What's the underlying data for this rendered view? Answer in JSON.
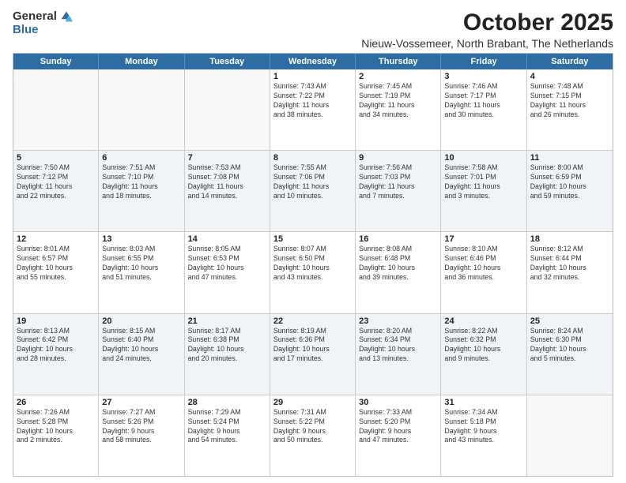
{
  "logo": {
    "general": "General",
    "blue": "Blue"
  },
  "title": "October 2025",
  "subtitle": "Nieuw-Vossemeer, North Brabant, The Netherlands",
  "headers": [
    "Sunday",
    "Monday",
    "Tuesday",
    "Wednesday",
    "Thursday",
    "Friday",
    "Saturday"
  ],
  "weeks": [
    [
      {
        "day": "",
        "info": ""
      },
      {
        "day": "",
        "info": ""
      },
      {
        "day": "",
        "info": ""
      },
      {
        "day": "1",
        "info": "Sunrise: 7:43 AM\nSunset: 7:22 PM\nDaylight: 11 hours\nand 38 minutes."
      },
      {
        "day": "2",
        "info": "Sunrise: 7:45 AM\nSunset: 7:19 PM\nDaylight: 11 hours\nand 34 minutes."
      },
      {
        "day": "3",
        "info": "Sunrise: 7:46 AM\nSunset: 7:17 PM\nDaylight: 11 hours\nand 30 minutes."
      },
      {
        "day": "4",
        "info": "Sunrise: 7:48 AM\nSunset: 7:15 PM\nDaylight: 11 hours\nand 26 minutes."
      }
    ],
    [
      {
        "day": "5",
        "info": "Sunrise: 7:50 AM\nSunset: 7:12 PM\nDaylight: 11 hours\nand 22 minutes."
      },
      {
        "day": "6",
        "info": "Sunrise: 7:51 AM\nSunset: 7:10 PM\nDaylight: 11 hours\nand 18 minutes."
      },
      {
        "day": "7",
        "info": "Sunrise: 7:53 AM\nSunset: 7:08 PM\nDaylight: 11 hours\nand 14 minutes."
      },
      {
        "day": "8",
        "info": "Sunrise: 7:55 AM\nSunset: 7:06 PM\nDaylight: 11 hours\nand 10 minutes."
      },
      {
        "day": "9",
        "info": "Sunrise: 7:56 AM\nSunset: 7:03 PM\nDaylight: 11 hours\nand 7 minutes."
      },
      {
        "day": "10",
        "info": "Sunrise: 7:58 AM\nSunset: 7:01 PM\nDaylight: 11 hours\nand 3 minutes."
      },
      {
        "day": "11",
        "info": "Sunrise: 8:00 AM\nSunset: 6:59 PM\nDaylight: 10 hours\nand 59 minutes."
      }
    ],
    [
      {
        "day": "12",
        "info": "Sunrise: 8:01 AM\nSunset: 6:57 PM\nDaylight: 10 hours\nand 55 minutes."
      },
      {
        "day": "13",
        "info": "Sunrise: 8:03 AM\nSunset: 6:55 PM\nDaylight: 10 hours\nand 51 minutes."
      },
      {
        "day": "14",
        "info": "Sunrise: 8:05 AM\nSunset: 6:53 PM\nDaylight: 10 hours\nand 47 minutes."
      },
      {
        "day": "15",
        "info": "Sunrise: 8:07 AM\nSunset: 6:50 PM\nDaylight: 10 hours\nand 43 minutes."
      },
      {
        "day": "16",
        "info": "Sunrise: 8:08 AM\nSunset: 6:48 PM\nDaylight: 10 hours\nand 39 minutes."
      },
      {
        "day": "17",
        "info": "Sunrise: 8:10 AM\nSunset: 6:46 PM\nDaylight: 10 hours\nand 36 minutes."
      },
      {
        "day": "18",
        "info": "Sunrise: 8:12 AM\nSunset: 6:44 PM\nDaylight: 10 hours\nand 32 minutes."
      }
    ],
    [
      {
        "day": "19",
        "info": "Sunrise: 8:13 AM\nSunset: 6:42 PM\nDaylight: 10 hours\nand 28 minutes."
      },
      {
        "day": "20",
        "info": "Sunrise: 8:15 AM\nSunset: 6:40 PM\nDaylight: 10 hours\nand 24 minutes."
      },
      {
        "day": "21",
        "info": "Sunrise: 8:17 AM\nSunset: 6:38 PM\nDaylight: 10 hours\nand 20 minutes."
      },
      {
        "day": "22",
        "info": "Sunrise: 8:19 AM\nSunset: 6:36 PM\nDaylight: 10 hours\nand 17 minutes."
      },
      {
        "day": "23",
        "info": "Sunrise: 8:20 AM\nSunset: 6:34 PM\nDaylight: 10 hours\nand 13 minutes."
      },
      {
        "day": "24",
        "info": "Sunrise: 8:22 AM\nSunset: 6:32 PM\nDaylight: 10 hours\nand 9 minutes."
      },
      {
        "day": "25",
        "info": "Sunrise: 8:24 AM\nSunset: 6:30 PM\nDaylight: 10 hours\nand 5 minutes."
      }
    ],
    [
      {
        "day": "26",
        "info": "Sunrise: 7:26 AM\nSunset: 5:28 PM\nDaylight: 10 hours\nand 2 minutes."
      },
      {
        "day": "27",
        "info": "Sunrise: 7:27 AM\nSunset: 5:26 PM\nDaylight: 9 hours\nand 58 minutes."
      },
      {
        "day": "28",
        "info": "Sunrise: 7:29 AM\nSunset: 5:24 PM\nDaylight: 9 hours\nand 54 minutes."
      },
      {
        "day": "29",
        "info": "Sunrise: 7:31 AM\nSunset: 5:22 PM\nDaylight: 9 hours\nand 50 minutes."
      },
      {
        "day": "30",
        "info": "Sunrise: 7:33 AM\nSunset: 5:20 PM\nDaylight: 9 hours\nand 47 minutes."
      },
      {
        "day": "31",
        "info": "Sunrise: 7:34 AM\nSunset: 5:18 PM\nDaylight: 9 hours\nand 43 minutes."
      },
      {
        "day": "",
        "info": ""
      }
    ]
  ]
}
